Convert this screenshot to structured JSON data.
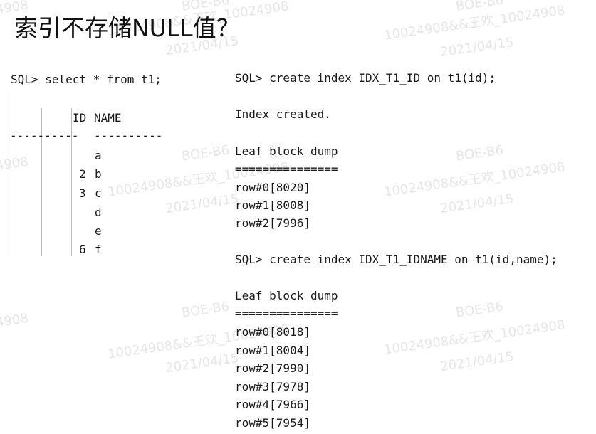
{
  "title": "索引不存储NULL值？",
  "watermark": {
    "code": "BOE-B6",
    "id": "10024908&&王欢_10024908",
    "date": "2021/04/15",
    "fragment": "4908"
  },
  "left": {
    "command": "SQL> select * from t1;",
    "header_id": "ID",
    "header_name": "NAME",
    "separator_id": "----------",
    "separator_name": "----------",
    "rows": [
      {
        "id": "",
        "name": "a"
      },
      {
        "id": "2",
        "name": "b"
      },
      {
        "id": "3",
        "name": "c"
      },
      {
        "id": "",
        "name": "d"
      },
      {
        "id": "",
        "name": "e"
      },
      {
        "id": "6",
        "name": "f"
      }
    ]
  },
  "right": {
    "cmd1": "SQL> create index IDX_T1_ID on t1(id);",
    "msg1": "Index created.",
    "dump1_title": "Leaf block dump",
    "dump1_rule": "===============",
    "dump1_rows": [
      "row#0[8020]",
      "row#1[8008]",
      "row#2[7996]"
    ],
    "cmd2": "SQL> create index IDX_T1_IDNAME on t1(id,name);",
    "dump2_title": "Leaf block dump",
    "dump2_rule": "===============",
    "dump2_rows": [
      "row#0[8018]",
      "row#1[8004]",
      "row#2[7990]",
      "row#3[7978]",
      "row#4[7966]",
      "row#5[7954]"
    ]
  }
}
